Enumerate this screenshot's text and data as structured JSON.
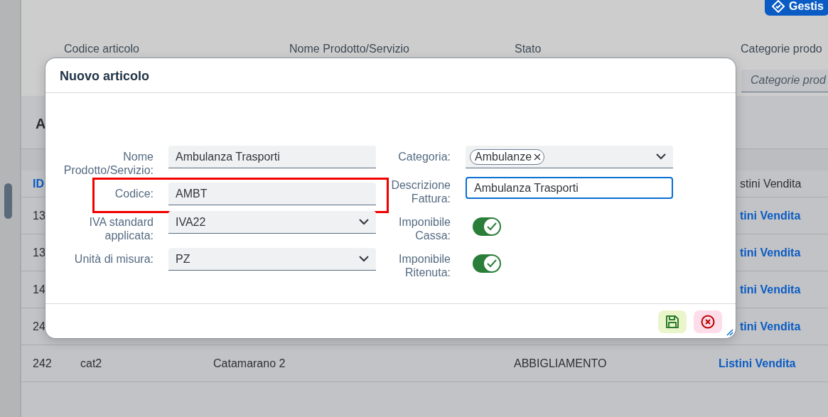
{
  "page": {
    "action_button": {
      "label": "Gestis"
    },
    "filters": [
      {
        "label": "Codice articolo"
      },
      {
        "label": "Nome Prodotto/Servizio"
      },
      {
        "label": "Stato"
      },
      {
        "label": "Categorie prodo"
      }
    ],
    "category_filter": {
      "placeholder": "Categorie prod"
    },
    "table": {
      "title": "A",
      "columns": [
        {
          "label": "ID",
          "kind": "sort"
        },
        {
          "label": "stini Vendita",
          "kind": "plain"
        }
      ],
      "rows": [
        {
          "cells": [
            "13"
          ],
          "link": "tini Vendita"
        },
        {
          "cells": [
            "13"
          ],
          "link": "tini Vendita"
        },
        {
          "cells": [
            "14"
          ],
          "link": "tini Vendita"
        },
        {
          "cells": [
            "24"
          ],
          "link": "tini Vendita"
        },
        {
          "cells": [
            "242",
            "cat2",
            "Catamarano 2",
            "ABBIGLIAMENTO"
          ],
          "link": "Listini Vendita"
        }
      ]
    }
  },
  "dialog": {
    "title": "Nuovo articolo",
    "left_fields": [
      {
        "kind": "text",
        "label": "Nome Prodotto/Servizio:",
        "value": "Ambulanza Trasporti",
        "highlighted": false
      },
      {
        "kind": "text",
        "label": "Codice:",
        "value": "AMBT",
        "highlighted": true
      },
      {
        "kind": "select",
        "label": "IVA standard applicata:",
        "value": "IVA22",
        "highlighted": false
      },
      {
        "kind": "select",
        "label": "Unità di misura:",
        "value": "PZ",
        "highlighted": false
      }
    ],
    "right_fields": [
      {
        "kind": "tokens",
        "label": "Categoria:",
        "tokens": [
          "Ambulanze"
        ]
      },
      {
        "kind": "text",
        "label": "Descrizione Fattura:",
        "value": "Ambulanza Trasporti",
        "focused": true
      },
      {
        "kind": "switch",
        "label": "Imponibile Cassa:",
        "on": true
      },
      {
        "kind": "switch",
        "label": "Imponibile Ritenuta:",
        "on": true
      }
    ],
    "buttons": [
      {
        "kind": "save"
      },
      {
        "kind": "cancel"
      }
    ]
  }
}
